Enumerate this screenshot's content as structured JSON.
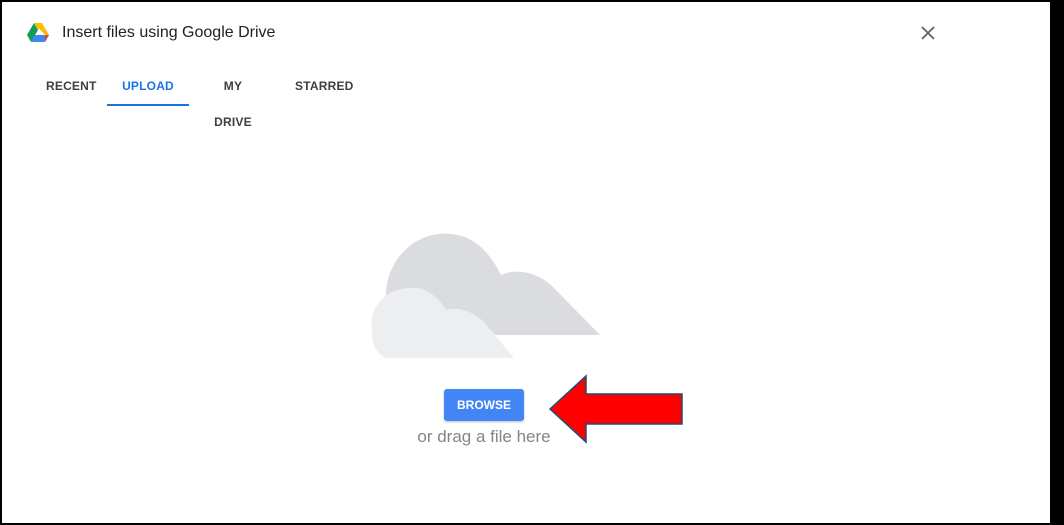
{
  "dialog": {
    "title": "Insert files using Google Drive",
    "logo_icon": "google-drive-icon",
    "close_icon": "close-icon"
  },
  "tabs": [
    {
      "label": "RECENT",
      "active": false
    },
    {
      "label": "UPLOAD",
      "active": true
    },
    {
      "label": "MY DRIVE",
      "active": false
    },
    {
      "label": "STARRED",
      "active": false
    }
  ],
  "upload": {
    "illustration_icon": "cloud-icon",
    "browse_label": "BROWSE",
    "drag_text": "or drag a file here"
  },
  "annotation": {
    "icon": "red-arrow-icon",
    "color": "#ff0000"
  },
  "colors": {
    "accent": "#1a73e8",
    "button": "#4285f4"
  }
}
